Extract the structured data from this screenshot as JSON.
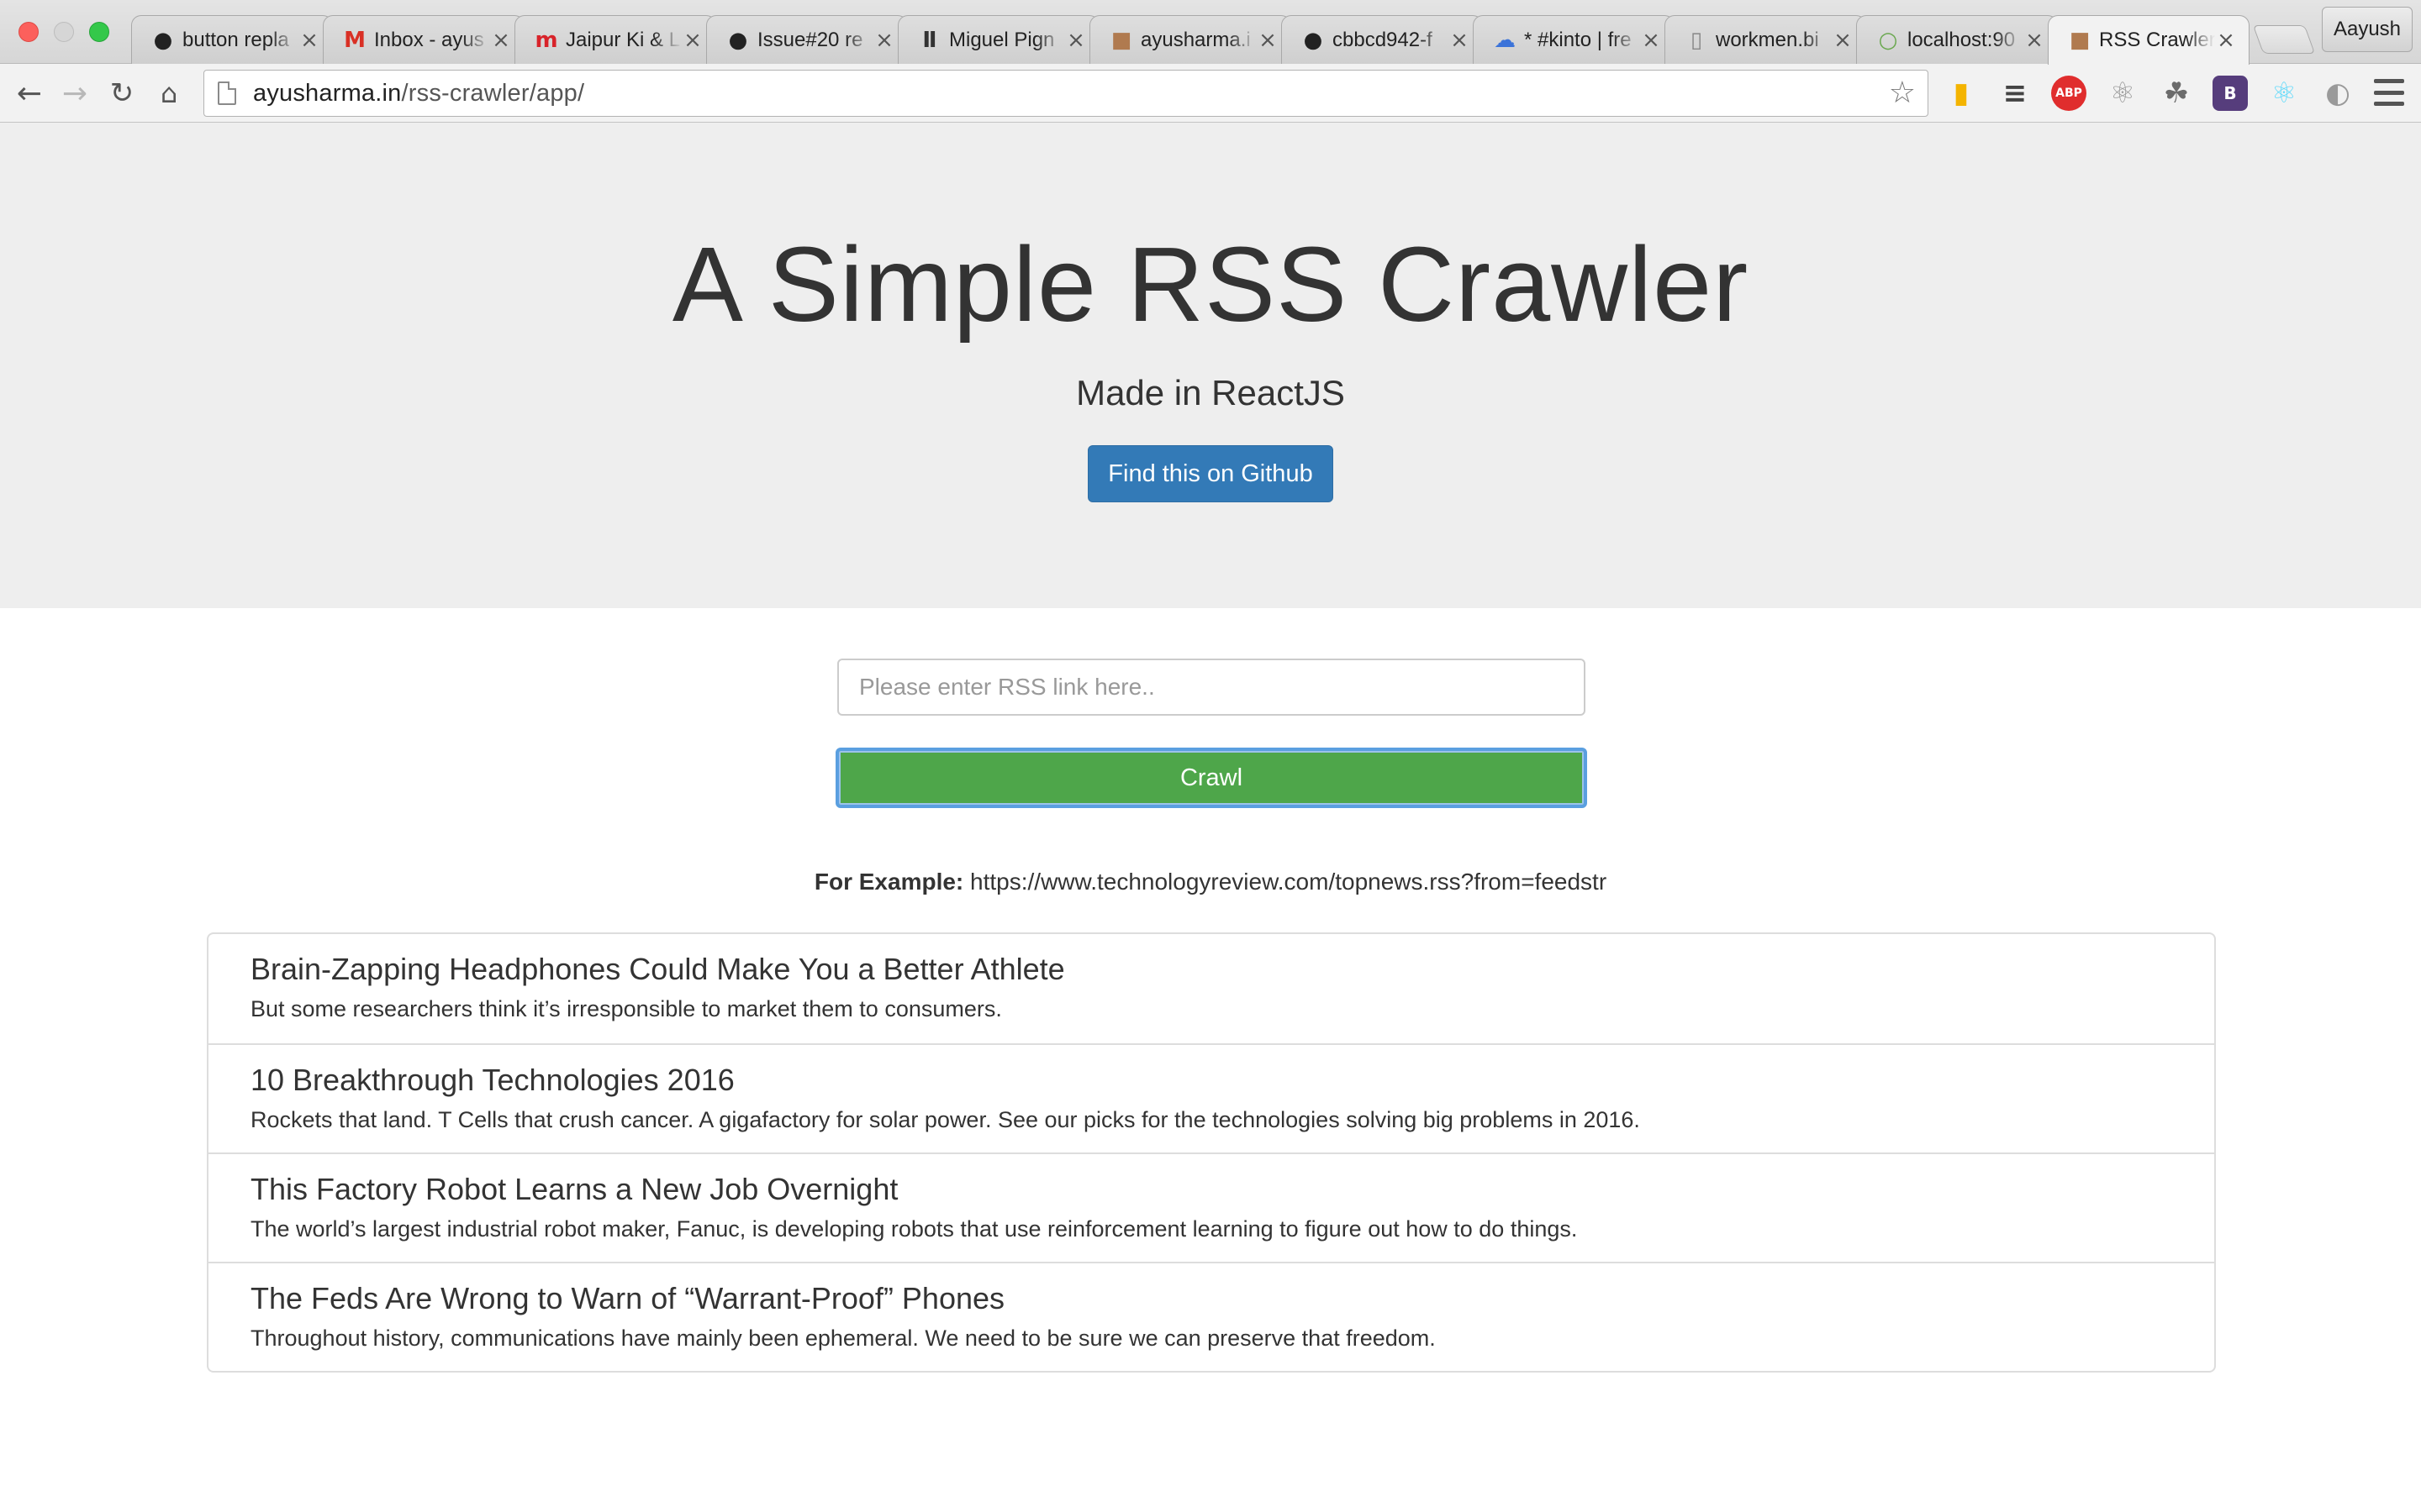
{
  "browser": {
    "tabs": [
      {
        "title": "button repla",
        "icon": "github-icon",
        "icon_char": "●",
        "icon_color": "#222222"
      },
      {
        "title": "Inbox - ayus",
        "icon": "gmail-icon",
        "icon_char": "M",
        "icon_color": "#d93025"
      },
      {
        "title": "Jaipur Ki & L",
        "icon": "my-logo-icon",
        "icon_char": "m",
        "icon_color": "#d8232a"
      },
      {
        "title": "Issue#20 re",
        "icon": "github-icon",
        "icon_char": "●",
        "icon_color": "#222222"
      },
      {
        "title": "Miguel Pign",
        "icon": "medium-icon",
        "icon_char": "Ⅱ",
        "icon_color": "#333333"
      },
      {
        "title": "ayusharma.i",
        "icon": "avatar-icon",
        "icon_char": "■",
        "icon_color": "#b07a4f"
      },
      {
        "title": "cbbcd942-f",
        "icon": "github-icon",
        "icon_char": "●",
        "icon_color": "#222222"
      },
      {
        "title": "* #kinto | fre",
        "icon": "irc-cloud-icon",
        "icon_char": "☁",
        "icon_color": "#3b73d9"
      },
      {
        "title": "workmen.bi",
        "icon": "page-icon",
        "icon_char": "▯",
        "icon_color": "#888888"
      },
      {
        "title": "localhost:90",
        "icon": "loading-icon",
        "icon_char": "○",
        "icon_color": "#6aa84f"
      },
      {
        "title": "RSS Crawler",
        "icon": "avatar-icon",
        "icon_char": "■",
        "icon_color": "#b07a4f"
      }
    ],
    "profile_name": "Aayush",
    "url_host": "ayusharma.in",
    "url_path": "/rss-crawler/app/",
    "extensions": [
      {
        "name": "phone-extension-icon",
        "char": "▮",
        "color": "#f4b400"
      },
      {
        "name": "traffic-extension-icon",
        "char": "≡",
        "color": "#444444"
      },
      {
        "name": "adblock-plus-icon",
        "char": "ABP",
        "color": "#e02d2d"
      },
      {
        "name": "atom-extension-icon",
        "char": "⚛",
        "color": "#9a9a9a"
      },
      {
        "name": "bug-extension-icon",
        "char": "☘",
        "color": "#6b6b6b"
      },
      {
        "name": "bootstrap-extension-icon",
        "char": "B",
        "color": "#563d7c"
      },
      {
        "name": "react-devtools-icon",
        "char": "⚛",
        "color": "#61dafb"
      },
      {
        "name": "grey-extension-icon",
        "char": "◐",
        "color": "#9a9a9a"
      }
    ]
  },
  "hero": {
    "title": "A Simple RSS Crawler",
    "subtitle": "Made in ReactJS",
    "github_button": "Find this on Github"
  },
  "form": {
    "placeholder": "Please enter RSS link here..",
    "crawl_button": "Crawl",
    "example_label": "For Example:",
    "example_url": "https://www.technologyreview.com/topnews.rss?from=feedstr"
  },
  "feed": [
    {
      "title": "Brain-Zapping Headphones Could Make You a Better Athlete",
      "summary": "But some researchers think it’s irresponsible to market them to consumers."
    },
    {
      "title": "10 Breakthrough Technologies 2016",
      "summary": "Rockets that land. T Cells that crush cancer. A gigafactory for solar power. See our picks for the technologies solving big problems in 2016."
    },
    {
      "title": "This Factory Robot Learns a New Job Overnight",
      "summary": "The world’s largest industrial robot maker, Fanuc, is developing robots that use reinforcement learning to figure out how to do things."
    },
    {
      "title": "The Feds Are Wrong to Warn of “Warrant-Proof” Phones",
      "summary": "Throughout history, communications have mainly been ephemeral. We need to be sure we can preserve that freedom."
    }
  ]
}
